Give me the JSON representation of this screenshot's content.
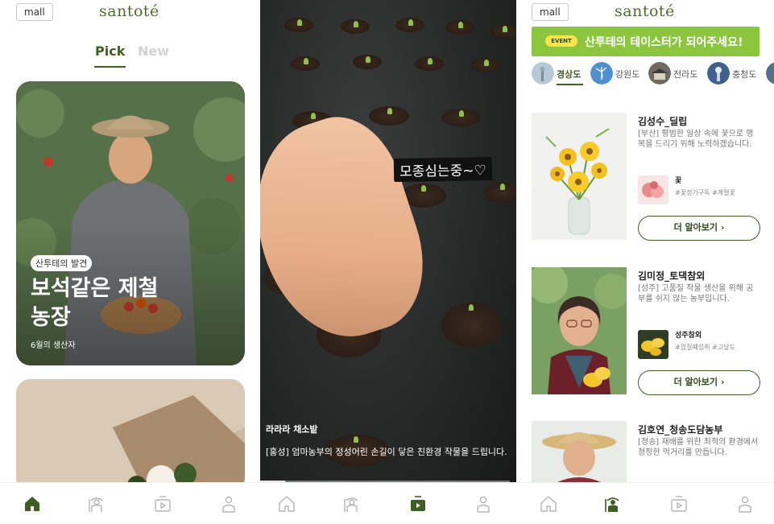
{
  "panel1": {
    "mall_label": "mall",
    "logo": "santoté",
    "tabs": [
      "Pick",
      "New"
    ],
    "feature": {
      "badge": "산투테의 발견",
      "title": "보석같은 제철농장",
      "subtitle": "6월의 생산자"
    }
  },
  "panel2": {
    "story_tag": "모종심는중~♡",
    "video_title": "라라라 채소밭",
    "video_desc": "[홍성] 엄마농부의 정성어린 손길이 닿은 친환경 작물을 드립니다.",
    "progress": 0.1
  },
  "panel3": {
    "mall_label": "mall",
    "logo": "santoté",
    "event_pill": "EVENT",
    "event_text": "산투테의 테이스터가 되어주세요!",
    "regions": [
      {
        "label": "경상도",
        "active": true
      },
      {
        "label": "강원도",
        "active": false
      },
      {
        "label": "전라도",
        "active": false
      },
      {
        "label": "충청도",
        "active": false
      }
    ],
    "farmers": [
      {
        "name": "김성수_딜립",
        "desc": "[부산] 평범한 일상 속에 꽃으로 행복을 드리기 위해 노력하겠습니다.",
        "product": "꽃",
        "tags": "#꽃정기구독 #계절꽃",
        "button": "더 알아보기 ›"
      },
      {
        "name": "김미정_토댁참외",
        "desc": "[성주] 고품질 작물 생산을 위해 공부를 쉬지 않는 농부입니다.",
        "product": "성주참외",
        "tags": "#껍질째섭취 #고당도",
        "button": "더 알아보기 ›"
      },
      {
        "name": "김호연_청송도담농부",
        "desc": "[청송] 재배를 위한 최적의 환경에서 청정한 먹거리를 만듭니다."
      }
    ]
  },
  "nav": {
    "icons": [
      "home-icon",
      "farmer-icon",
      "video-icon",
      "profile-icon"
    ],
    "active_color": "#3f5e24",
    "inactive_color": "#b5b5b5"
  }
}
